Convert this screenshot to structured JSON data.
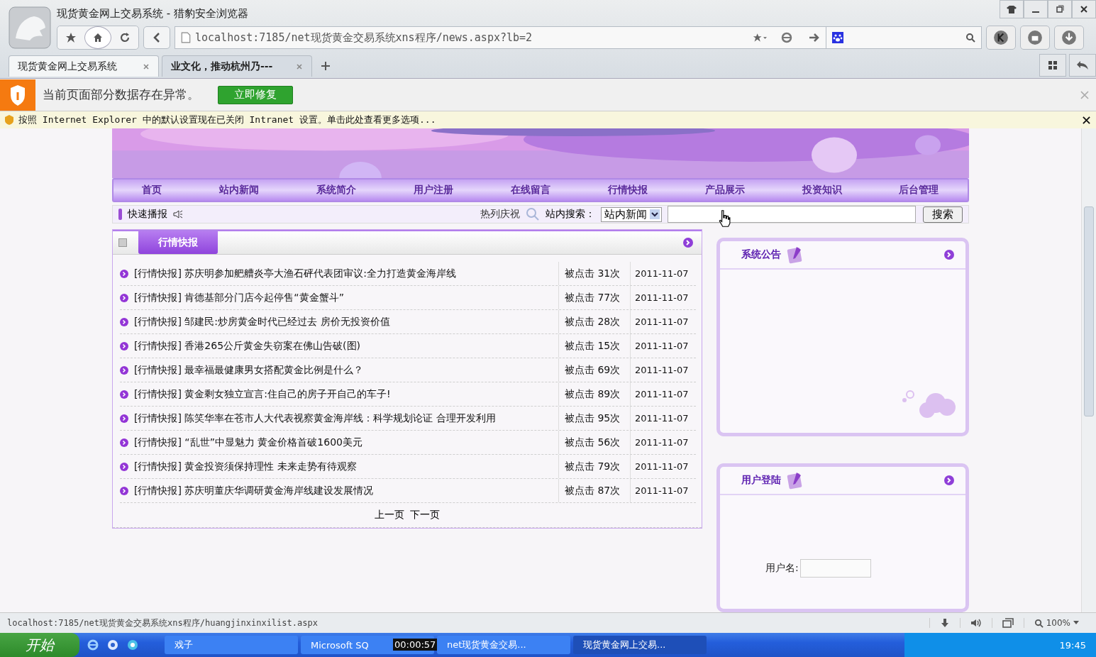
{
  "browser": {
    "title": "现货黄金网上交易系统 - 猎豹安全浏览器",
    "url": "localhost:7185/net现货黄金交易系统xns程序/news.aspx?lb=2",
    "tabs": [
      {
        "label": "现货黄金网上交易系统",
        "selected": true
      },
      {
        "label": "业文化，推动杭州乃---",
        "selected": false
      }
    ],
    "notice": {
      "message": "当前页面部分数据存在异常。",
      "button": "立即修复"
    },
    "infobar": "按照 Internet Explorer 中的默认设置现在已关闭 Intranet 设置。单击此处查看更多选项...",
    "status_url": "localhost:7185/net现货黄金交易系统xns程序/huangjinxinxilist.aspx",
    "zoom": "100%"
  },
  "nav": [
    "首页",
    "站内新闻",
    "系统简介",
    "用户注册",
    "在线留言",
    "行情快报",
    "产品展示",
    "投资知识",
    "后台管理"
  ],
  "ticker": {
    "label": "快速播报",
    "marquee": "热列庆祝"
  },
  "search": {
    "label": "站内搜索：",
    "scope": "站内新闻",
    "button": "搜索"
  },
  "news": {
    "title": "行情快报",
    "rows": [
      {
        "category": "[行情快报]",
        "title": "苏庆明参加舥艚炎亭大渔石砰代表团审议:全力打造黄金海岸线",
        "clicks": "被点击 31次",
        "date": "2011-11-07"
      },
      {
        "category": "[行情快报]",
        "title": "肯德基部分门店今起停售“黄金蟹斗”",
        "clicks": "被点击 77次",
        "date": "2011-11-07"
      },
      {
        "category": "[行情快报]",
        "title": "邹建民:炒房黄金时代已经过去 房价无投资价值",
        "clicks": "被点击 28次",
        "date": "2011-11-07"
      },
      {
        "category": "[行情快报]",
        "title": "香港265公斤黄金失窃案在佛山告破(图)",
        "clicks": "被点击 15次",
        "date": "2011-11-07"
      },
      {
        "category": "[行情快报]",
        "title": "最幸福最健康男女搭配黄金比例是什么？",
        "clicks": "被点击 69次",
        "date": "2011-11-07"
      },
      {
        "category": "[行情快报]",
        "title": "黄金剩女独立宣言:住自己的房子开自己的车子!",
        "clicks": "被点击 89次",
        "date": "2011-11-07"
      },
      {
        "category": "[行情快报]",
        "title": "陈笑华率在苍市人大代表视察黄金海岸线：科学规划论证 合理开发利用",
        "clicks": "被点击 95次",
        "date": "2011-11-07"
      },
      {
        "category": "[行情快报]",
        "title": "“乱世”中显魅力 黄金价格首破1600美元",
        "clicks": "被点击 56次",
        "date": "2011-11-07"
      },
      {
        "category": "[行情快报]",
        "title": "黄金投资须保持理性 未来走势有待观察",
        "clicks": "被点击 79次",
        "date": "2011-11-07"
      },
      {
        "category": "[行情快报]",
        "title": "苏庆明董庆华调研黄金海岸线建设发展情况",
        "clicks": "被点击 87次",
        "date": "2011-11-07"
      }
    ],
    "pager": [
      "上一页",
      "下一页"
    ]
  },
  "side": {
    "notice_title": "系统公告",
    "login_title": "用户登陆",
    "username_label": "用户名:"
  },
  "taskbar": {
    "start": "开始",
    "tasks": [
      {
        "label": "戏子",
        "selected": false
      },
      {
        "label": "Microsoft SQ",
        "selected": false
      },
      {
        "label": "net现货黄金交易...",
        "selected": false
      },
      {
        "label": "现货黄金网上交易...",
        "selected": true
      }
    ],
    "clock": "19:45",
    "timer": "00:00:57"
  }
}
